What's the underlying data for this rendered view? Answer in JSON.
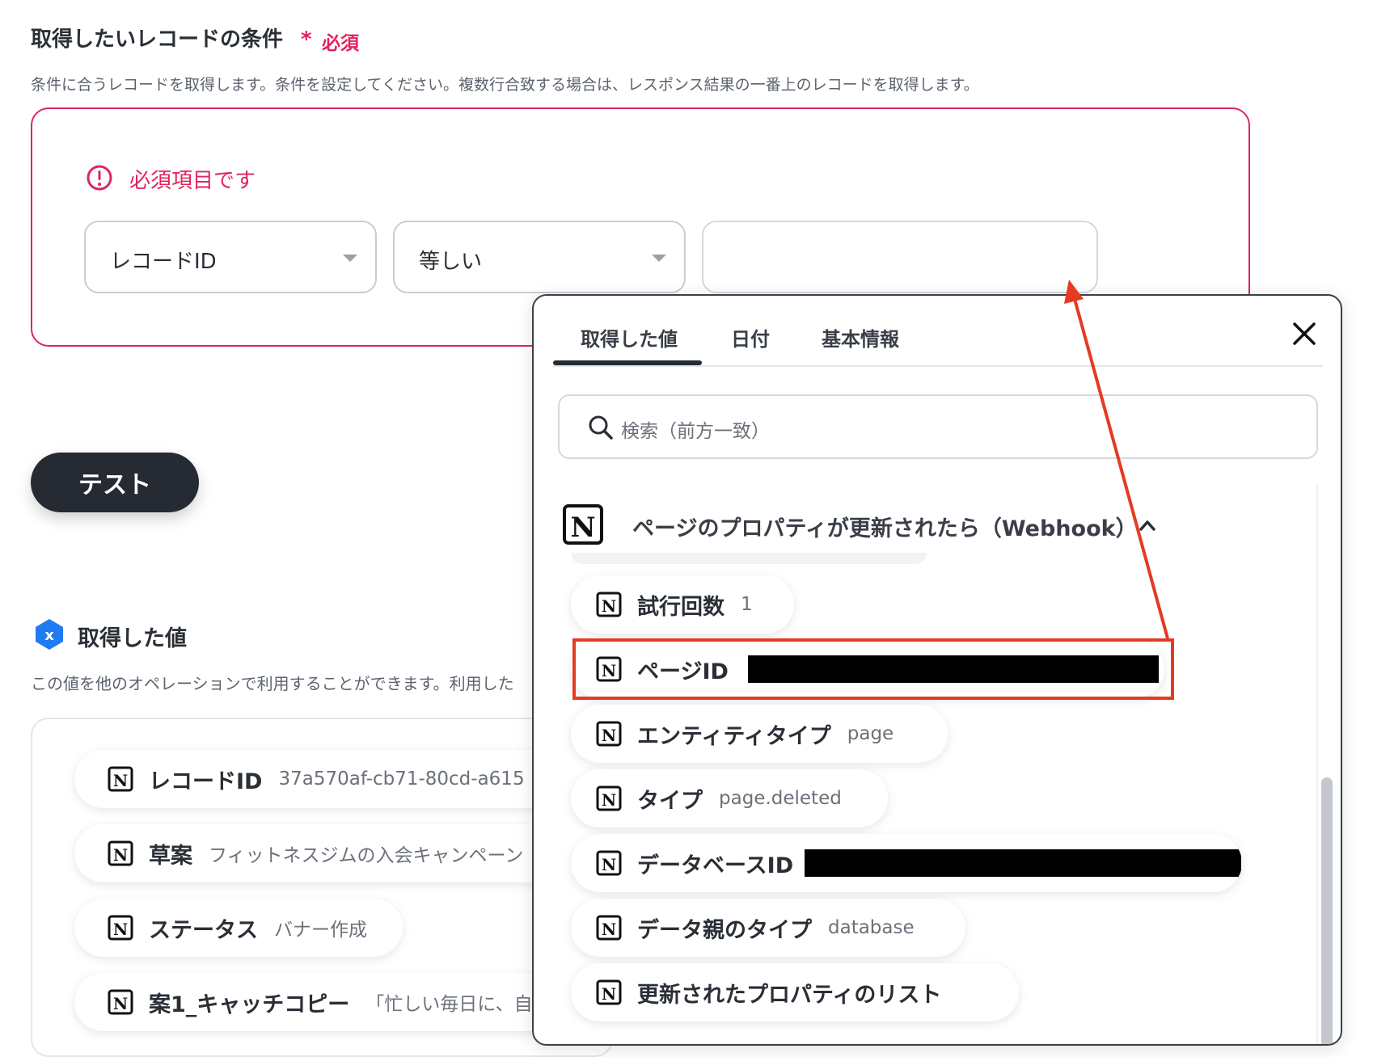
{
  "section": {
    "title": "取得したいレコードの条件",
    "required_star": "*",
    "required_label": "必須",
    "description": "条件に合うレコードを取得します。条件を設定してください。複数行合致する場合は、レスポンス結果の一番上のレコードを取得します。"
  },
  "condition": {
    "error_text": "必須項目です",
    "field_select": "レコードID",
    "operator_select": "等しい",
    "value_input": ""
  },
  "test_button": "テスト",
  "fetched": {
    "badge": "x",
    "title": "取得した値",
    "description": "この値を他のオペレーションで利用することができます。利用した",
    "items": [
      {
        "name": "レコードID",
        "value": "37a570af-cb71-80cd-a615"
      },
      {
        "name": "草案",
        "value": "フィットネスジムの入会キャンペーン"
      },
      {
        "name": "ステータス",
        "value": "バナー作成"
      },
      {
        "name": "案1_キャッチコピー",
        "value": "「忙しい毎日に、自分"
      }
    ]
  },
  "popover": {
    "tabs": [
      "取得した値",
      "日付",
      "基本情報"
    ],
    "active_tab": 0,
    "search_placeholder": "検索（前方一致）",
    "group_title": "ページのプロパティが更新されたら（Webhook）",
    "items": [
      {
        "name": "試行回数",
        "value": "1"
      },
      {
        "name": "ページID",
        "value": ""
      },
      {
        "name": "エンティティタイプ",
        "value": "page"
      },
      {
        "name": "タイプ",
        "value": "page.deleted"
      },
      {
        "name": "データベースID",
        "value": ""
      },
      {
        "name": "データ親のタイプ",
        "value": "database"
      },
      {
        "name": "更新されたプロパティのリスト",
        "value": ""
      }
    ]
  },
  "colors": {
    "error": "#e0245e",
    "annotation": "#e63a22",
    "dark_button": "#262b33",
    "badge": "#1e7bf2"
  }
}
